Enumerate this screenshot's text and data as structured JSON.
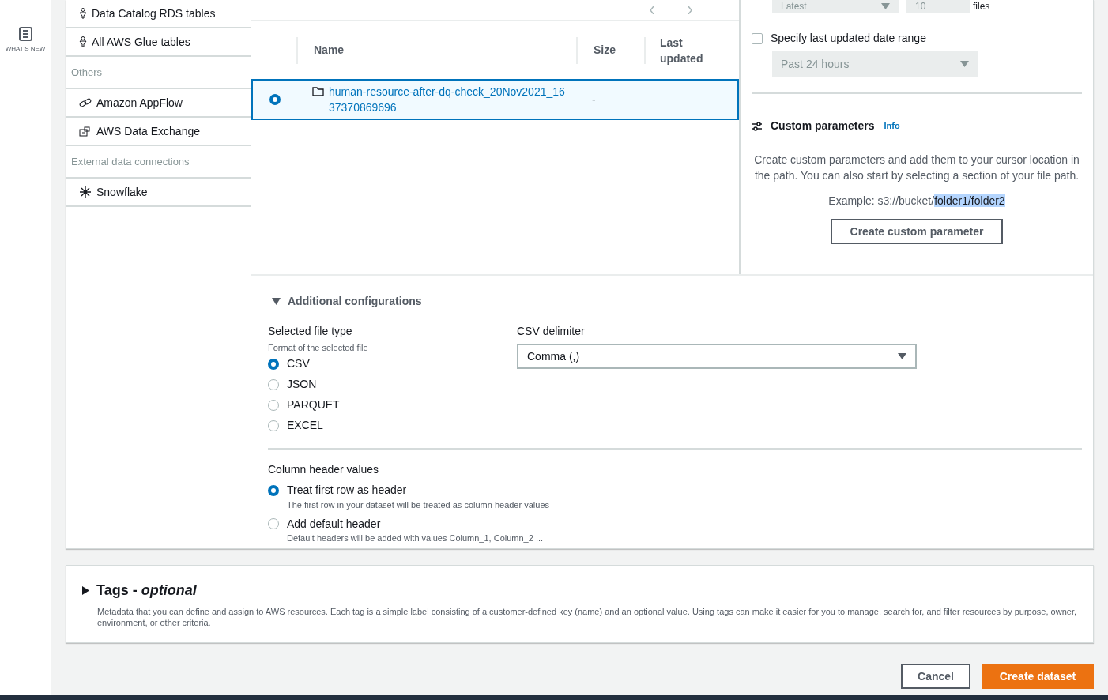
{
  "nav_rail": {
    "items": [
      {
        "label": "WHAT'S NEW"
      }
    ]
  },
  "source_list": {
    "items": [
      {
        "kind": "item",
        "label": "Data Catalog RDS tables"
      },
      {
        "kind": "item",
        "label": "All AWS Glue tables"
      },
      {
        "kind": "heading",
        "label": "Others"
      },
      {
        "kind": "item",
        "label": "Amazon AppFlow"
      },
      {
        "kind": "item",
        "label": "AWS Data Exchange"
      },
      {
        "kind": "heading",
        "label": "External data connections"
      },
      {
        "kind": "item",
        "label": "Snowflake"
      }
    ]
  },
  "table": {
    "columns": [
      "Name",
      "Size",
      "Last updated"
    ],
    "rows": [
      {
        "selected": true,
        "name": "human-resource-after-dq-check_20Nov2021_1637370869696",
        "size": "-"
      }
    ]
  },
  "file_limit": {
    "order": "Latest",
    "count": "10",
    "unit": "files"
  },
  "date_range": {
    "checked": false,
    "label": "Specify last updated date range",
    "value": "Past 24 hours"
  },
  "custom_parameters": {
    "title": "Custom parameters",
    "info": "Info",
    "description": "Create custom parameters and add them to your cursor location in the path. You can also start by selecting a section of your file path.",
    "example": "Example: s3://bucket/",
    "example_selected": "folder1/folder2",
    "button": "Create custom parameter"
  },
  "additional_configurations": {
    "expanded": true,
    "title": "Additional configurations",
    "file_type": {
      "label": "Selected file type",
      "hint": "Format of the selected file",
      "options": [
        {
          "label": "CSV",
          "selected": true
        },
        {
          "label": "JSON",
          "selected": false
        },
        {
          "label": "PARQUET",
          "selected": false
        },
        {
          "label": "EXCEL",
          "selected": false
        }
      ]
    },
    "csv_delimiter": {
      "label": "CSV delimiter",
      "value": "Comma (,)"
    },
    "column_header": {
      "label": "Column header values",
      "options": [
        {
          "label": "Treat first row as header",
          "description": "The first row in your dataset will be treated as column header values",
          "selected": true
        },
        {
          "label": "Add default header",
          "description": "Default headers will be added with values Column_1, Column_2 ...",
          "selected": false
        }
      ]
    }
  },
  "tags": {
    "expanded": false,
    "title": "Tags - *optional*",
    "description": "Metadata that you can define and assign to AWS resources. Each tag is a simple label consisting of a customer-defined key (name) and an optional value. Using tags can make it easier for you to manage, search for, and filter resources by purpose, owner, environment, or other criteria."
  },
  "footer": {
    "cancel": "Cancel",
    "create": "Create dataset"
  }
}
